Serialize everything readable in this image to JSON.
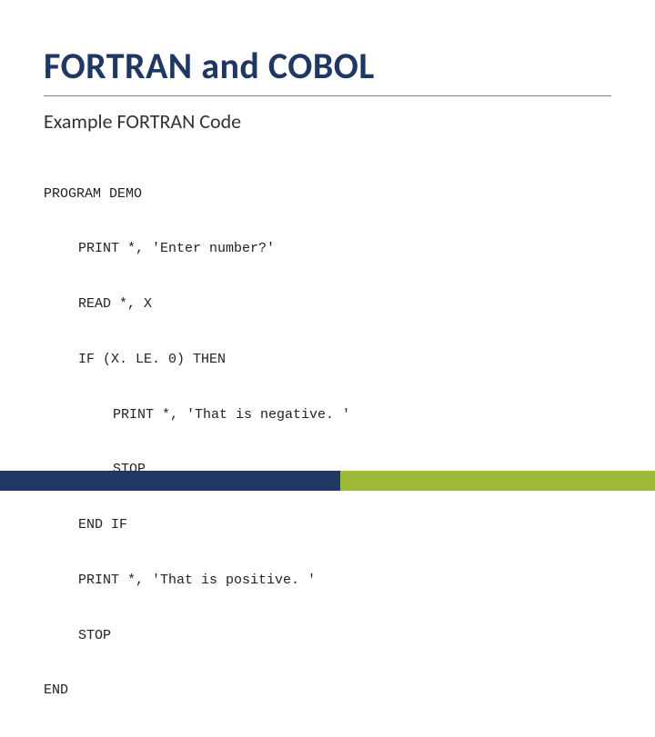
{
  "title": "FORTRAN and COBOL",
  "subtitle": "Example FORTRAN Code",
  "code": {
    "l0": "PROGRAM DEMO",
    "l1": "PRINT *, 'Enter number?'",
    "l2": "READ *, X",
    "l3": "IF (X. LE. 0) THEN",
    "l4": "PRINT *, 'That is negative. '",
    "l5": "STOP",
    "l6": "END IF",
    "l7": "PRINT *, 'That is positive. '",
    "l8": "STOP",
    "l9": "END"
  }
}
